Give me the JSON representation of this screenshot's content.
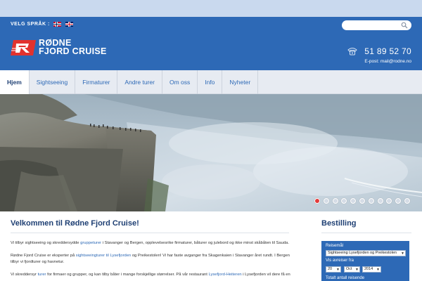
{
  "header": {
    "language_label": "VELG SPRÅK :",
    "languages": [
      {
        "name": "Norsk",
        "icon": "norwegian-flag-icon"
      },
      {
        "name": "English",
        "icon": "uk-flag-icon"
      }
    ],
    "search": {
      "placeholder": "",
      "icon": "search-icon"
    },
    "logo": {
      "line1": "RØDNE",
      "line2": "FJORD CRUISE"
    },
    "phone": "51 89 52 70",
    "email": "E-post: mail@rodne.no"
  },
  "nav": {
    "items": [
      "Hjem",
      "Sightseeing",
      "Firmaturer",
      "Andre turer",
      "Om oss",
      "Info",
      "Nyheter"
    ],
    "active_index": 0
  },
  "slider": {
    "slide_count": 11,
    "active_index": 0
  },
  "main": {
    "title": "Velkommen til Rødne Fjord Cruise!",
    "p1_a": "Vi tilbyr sightseeing og skreddersydde ",
    "p1_link": "gruppeturer",
    "p1_b": " i Stavanger og Bergen, opplevelsesrike firmaturer, båturer og julebord og ikke minst skåbåten til Sauda.",
    "p2_a": "Rødne Fjord Cruise er eksperter på ",
    "p2_link": "sightseeingturer til Lysefjorden",
    "p2_b": " og Preikestolen! Vi har faste avganger fra Skagenkaien i Stavanger året rundt. I Bergen tilbyr vi fjordturer og havnetur.",
    "p3_a": "Vi skreddersyr ",
    "p3_link1": "turer",
    "p3_b": " for firmaer og grupper, og kan tilby båter i mange forskjellige størrelser. På vår restaurant ",
    "p3_link2": "Lysefjord-Heiteren",
    "p3_c": " i Lysefjorden vil dere få en"
  },
  "sidebar": {
    "title": "Bestilling",
    "destination_label": "Reisemål",
    "destination_value": "Sightseeing Lysefjorden og Preikestolen",
    "date_label": "Vis avreiser fra",
    "day_value": "20",
    "month_value": "Oct",
    "year_value": "2014",
    "count_label": "Totalt antall reisende"
  },
  "colors": {
    "header_blue": "#2d69b6",
    "top_strip": "#c9d9ee",
    "nav_bg": "#e7ebf2",
    "title_navy": "#1e3f73",
    "active_dot": "#e33a3a"
  }
}
